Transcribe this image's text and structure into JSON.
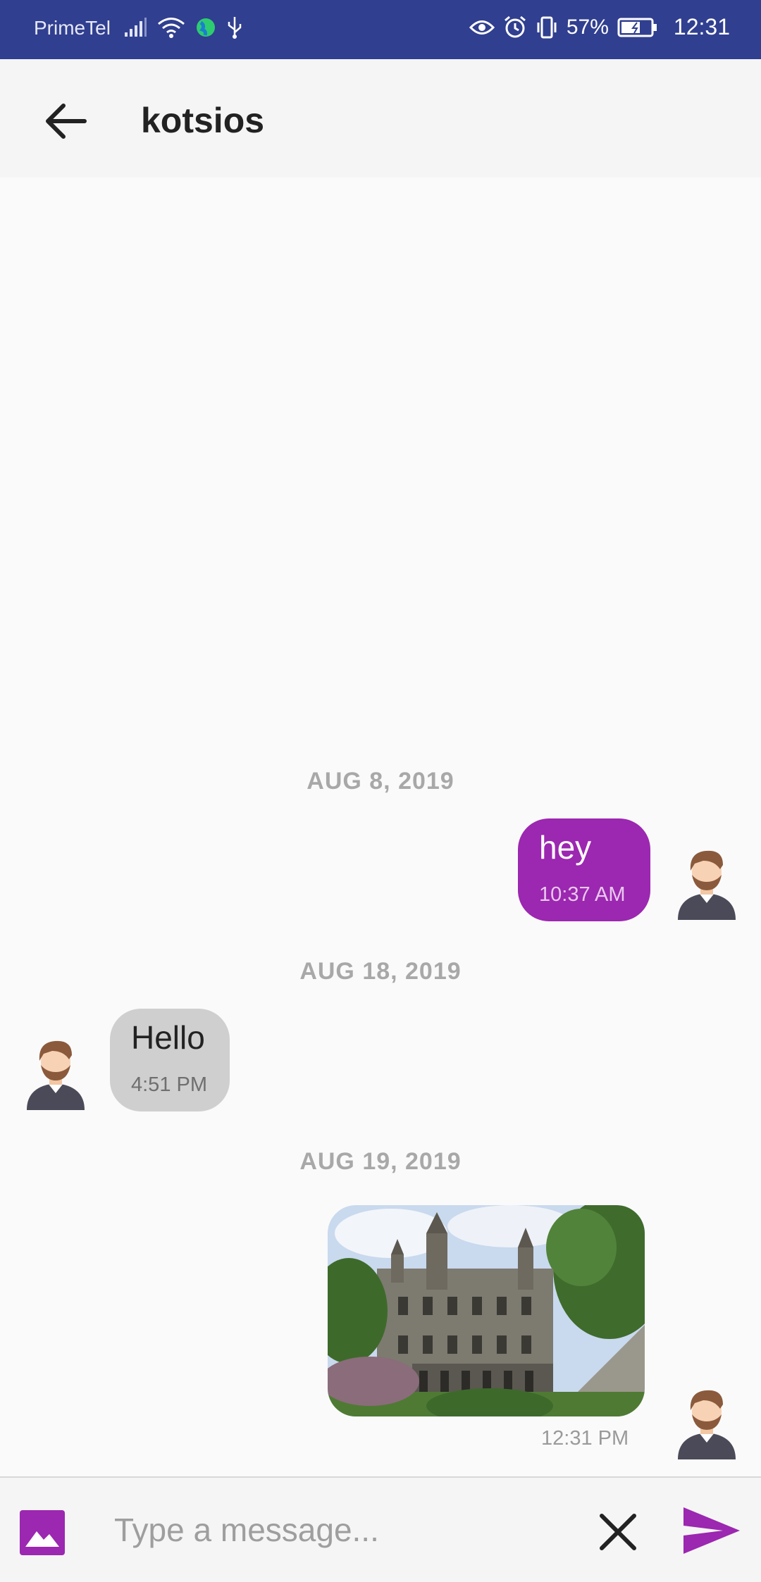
{
  "status_bar": {
    "carrier": "PrimeTel",
    "battery_percent": "57%",
    "time": "12:31"
  },
  "app_bar": {
    "title": "kotsios"
  },
  "messages": [
    {
      "date": "AUG 8, 2019",
      "direction": "outgoing",
      "text": "hey",
      "time": "10:37 AM"
    },
    {
      "date": "AUG 18, 2019",
      "direction": "incoming",
      "text": "Hello",
      "time": "4:51 PM"
    },
    {
      "date": "AUG 19, 2019",
      "direction": "outgoing",
      "type": "image",
      "time": "12:31 PM"
    }
  ],
  "composer": {
    "placeholder": "Type a message..."
  },
  "colors": {
    "status_bar": "#303f8f",
    "accent": "#9c27b0",
    "incoming_bubble": "#cfcfcf"
  },
  "icons": [
    "signal-icon",
    "wifi-icon",
    "globe-icon",
    "usb-icon",
    "eye-icon",
    "alarm-icon",
    "vibrate-icon",
    "battery-icon",
    "back-arrow-icon",
    "avatar-icon",
    "gallery-icon",
    "close-icon",
    "send-icon"
  ]
}
